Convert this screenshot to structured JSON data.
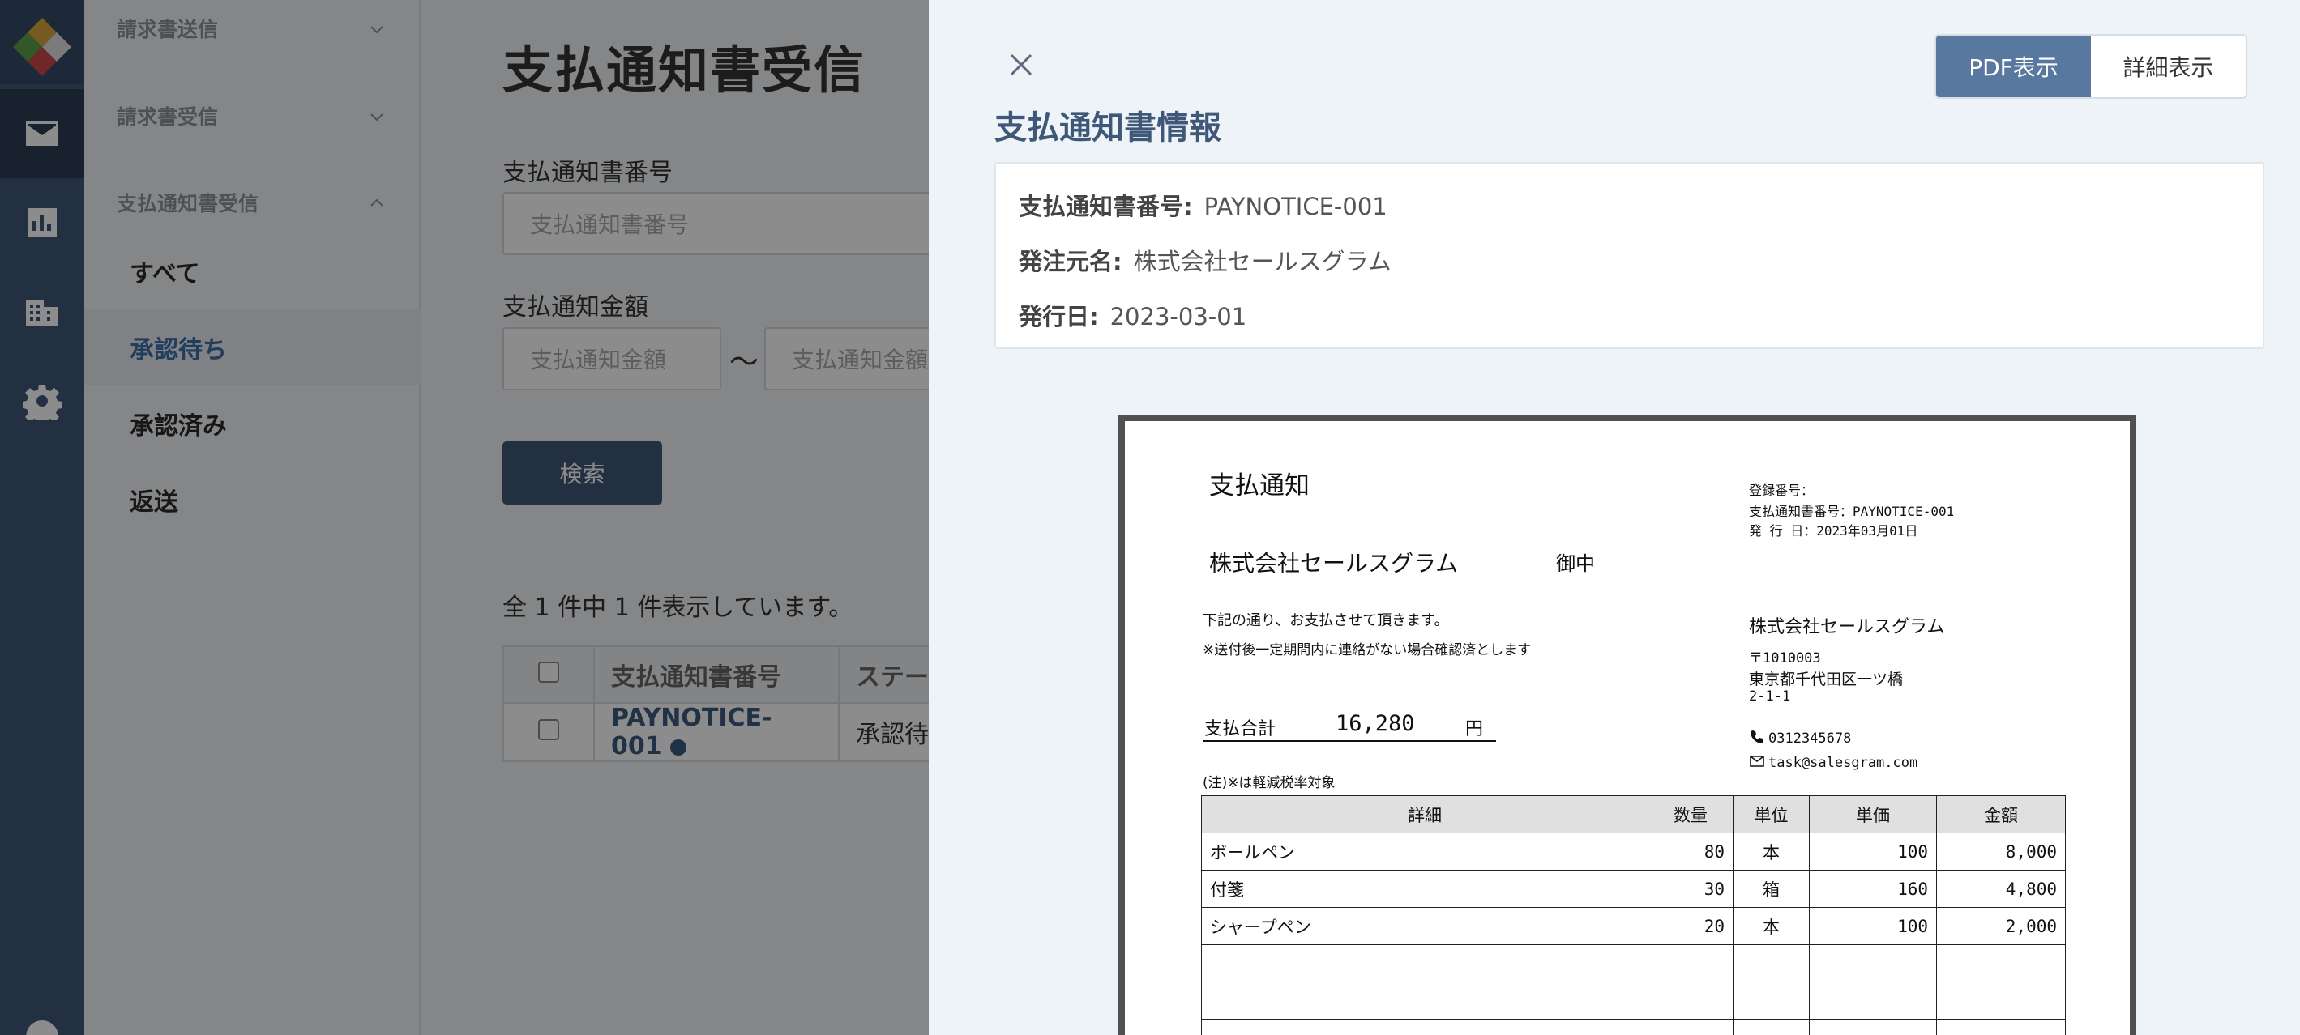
{
  "colors": {
    "rail": "#3f5877",
    "accent": "#3d6fa8",
    "pdf_toggle_active": "#5878a0"
  },
  "rail": {
    "icons": [
      "logo",
      "mail-icon",
      "chart-icon",
      "building-icon",
      "gear-icon",
      "help-icon"
    ],
    "active": "mail-icon"
  },
  "subnav": {
    "groups": [
      {
        "label": "請求書送信",
        "expanded": false
      },
      {
        "label": "請求書受信",
        "expanded": false
      },
      {
        "label": "支払通知書受信",
        "expanded": true
      }
    ],
    "items": [
      {
        "label": "すべて"
      },
      {
        "label": "承認待ち",
        "active": true
      },
      {
        "label": "承認済み"
      },
      {
        "label": "返送"
      }
    ]
  },
  "main": {
    "title": "支払通知書受信",
    "number_label": "支払通知書番号",
    "number_placeholder": "支払通知書番号",
    "amount_label": "支払通知金額",
    "amount_from_placeholder": "支払通知金額",
    "amount_to_placeholder": "支払通知金額",
    "tilde": "〜",
    "search_button": "検索",
    "result_count": "全 1 件中 1 件表示しています。",
    "table": {
      "headers": [
        "支払通知書番号",
        "ステータス"
      ],
      "rows": [
        {
          "number": "PAYNOTICE-001",
          "status": "承認待ち"
        }
      ]
    }
  },
  "drawer": {
    "toggle": {
      "pdf": "PDF表示",
      "detail": "詳細表示",
      "active": "pdf"
    },
    "title": "支払通知書情報",
    "info": {
      "number_label": "支払通知書番号:",
      "number_value": "PAYNOTICE-001",
      "buyer_label": "発注元名:",
      "buyer_value": "株式会社セールスグラム",
      "date_label": "発行日:",
      "date_value": "2023-03-01"
    }
  },
  "pdf": {
    "title": "支払通知",
    "reg_no": "登録番号：",
    "notice_no": "支払通知書番号：PAYNOTICE-001",
    "issue_date": "発 行 日：2023年03月01日",
    "customer": "株式会社セールスグラム",
    "honorific": "御中",
    "note1": "下記の通り、お支払させて頂きます。",
    "note2": "※送付後一定期間内に連絡がない場合確認済とします",
    "total_label": "支払合計",
    "total_value": "16,280",
    "yen": "円",
    "reduced_note": "(注)※は軽減税率対象",
    "issuer_name": "株式会社セールスグラム",
    "issuer_zip": "〒1010003",
    "issuer_addr1": "東京都千代田区一ツ橋",
    "issuer_addr2": "2-1-1",
    "issuer_tel": "0312345678",
    "issuer_mail": "task@salesgram.com",
    "table_headers": [
      "詳細",
      "数量",
      "単位",
      "単価",
      "金額"
    ],
    "lines": [
      {
        "detail": "ボールペン",
        "qty": "80",
        "unit": "本",
        "price": "100",
        "amount": "8,000"
      },
      {
        "detail": "付箋",
        "qty": "30",
        "unit": "箱",
        "price": "160",
        "amount": "4,800"
      },
      {
        "detail": "シャープペン",
        "qty": "20",
        "unit": "本",
        "price": "100",
        "amount": "2,000"
      }
    ]
  }
}
